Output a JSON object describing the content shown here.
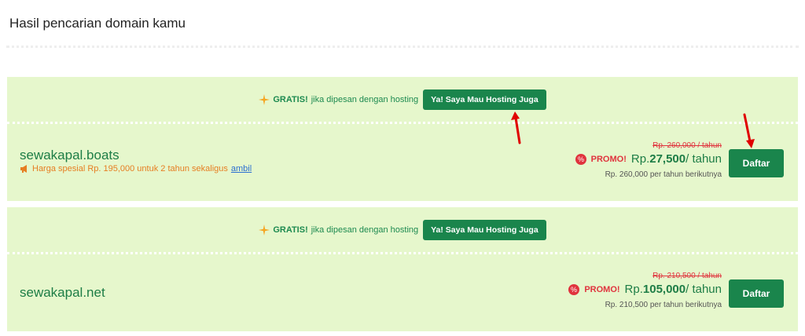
{
  "header": {
    "title": "Hasil pencarian domain kamu"
  },
  "results": [
    {
      "gratis": "GRATIS!",
      "gratis_text": "jika dipesan dengan hosting",
      "hosting_button": "Ya! Saya Mau Hosting Juga",
      "domain": "sewakapal.boats",
      "special_offer": "Harga spesial Rp. 195,000 untuk 2 tahun sekaligus",
      "special_offer_link": "ambil",
      "old_price": "Rp. 260,000 / tahun",
      "promo_label": "PROMO!",
      "price_prefix": "Rp.",
      "price_value": "27,500",
      "price_suffix": "/ tahun",
      "renewal": "Rp. 260,000 per tahun berikutnya",
      "register_button": "Daftar"
    },
    {
      "gratis": "GRATIS!",
      "gratis_text": "jika dipesan dengan hosting",
      "hosting_button": "Ya! Saya Mau Hosting Juga",
      "domain": "sewakapal.net",
      "old_price": "Rp. 210,500 / tahun",
      "promo_label": "PROMO!",
      "price_prefix": "Rp.",
      "price_value": "105,000",
      "price_suffix": "/ tahun",
      "renewal": "Rp. 210,500 per tahun berikutnya",
      "register_button": "Daftar"
    }
  ],
  "colors": {
    "card_bg": "#e6f7cc",
    "accent_green": "#1a854c",
    "promo_red": "#e0333d",
    "offer_orange": "#e67e22",
    "annotation_arrow": "#e00000"
  },
  "icons": [
    "sparkle-icon",
    "megaphone-icon",
    "promo-badge-icon",
    "annotation-arrow"
  ]
}
